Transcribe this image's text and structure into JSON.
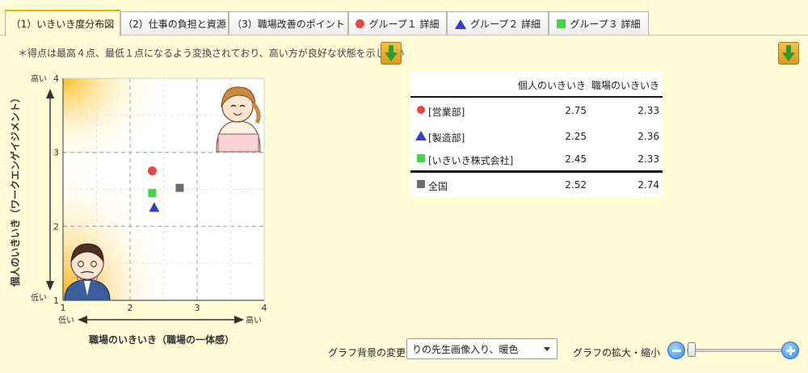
{
  "tabs": [
    {
      "label": "（1）いきいき度分布図",
      "active": true
    },
    {
      "label": "（2）仕事の負担と資源"
    },
    {
      "label": "（3）職場改善のポイント"
    },
    {
      "label": "グループ１ 詳細",
      "icon": "red-circle-icon"
    },
    {
      "label": "グループ２ 詳細",
      "icon": "blue-triangle-icon"
    },
    {
      "label": "グループ３ 詳細",
      "icon": "green-square-icon"
    }
  ],
  "note": "＊得点は最高４点、最低１点になるよう変換されており、高い方が良好な状態を示してい",
  "chart_data": {
    "type": "scatter",
    "xlabel": "職場のいきいき（職場の一体感）",
    "ylabel": "個人のいきいき（ワークエンゲイジメント）",
    "xlim": [
      1,
      4
    ],
    "ylim": [
      1,
      4
    ],
    "x_ticks": [
      "1",
      "2",
      "3",
      "4"
    ],
    "y_ticks": [
      "1",
      "2",
      "3",
      "4"
    ],
    "x_low": "低い",
    "x_high": "高い",
    "y_low": "低い",
    "y_high": "高い",
    "grid": true,
    "series": [
      {
        "name": "[営業部]",
        "marker": "circle",
        "color": "#e84545",
        "x": 2.33,
        "y": 2.75
      },
      {
        "name": "[製造部]",
        "marker": "triangle",
        "color": "#3b3bd0",
        "x": 2.36,
        "y": 2.25
      },
      {
        "name": "[いきいき株式会社]",
        "marker": "square",
        "color": "#44d44a",
        "x": 2.33,
        "y": 2.45
      },
      {
        "name": "全国",
        "marker": "square",
        "color": "#6c6c6c",
        "x": 2.74,
        "y": 2.52
      }
    ]
  },
  "table": {
    "headers": [
      "個人のいきいき",
      "職場のいきいき"
    ],
    "rows": [
      {
        "name": "[営業部]",
        "marker": "circle",
        "v1": "2.75",
        "v2": "2.33"
      },
      {
        "name": "[製造部]",
        "marker": "triangle",
        "v1": "2.25",
        "v2": "2.36"
      },
      {
        "name": "[いきいき株式会社]",
        "marker": "square",
        "v1": "2.45",
        "v2": "2.33"
      }
    ],
    "total": {
      "name": "全国",
      "marker": "dark-square",
      "v1": "2.52",
      "v2": "2.74"
    }
  },
  "controls": {
    "background_label": "グラフ背景の変更",
    "background_value": "りの先生画像入り、暖色",
    "zoom_label": "グラフの拡大・縮小",
    "zoom_level": 0.0
  },
  "colors": {
    "page_bg": "#fffcd7",
    "warm_gradient": "#f8b400",
    "tab_active_accent": "#f0b000"
  }
}
